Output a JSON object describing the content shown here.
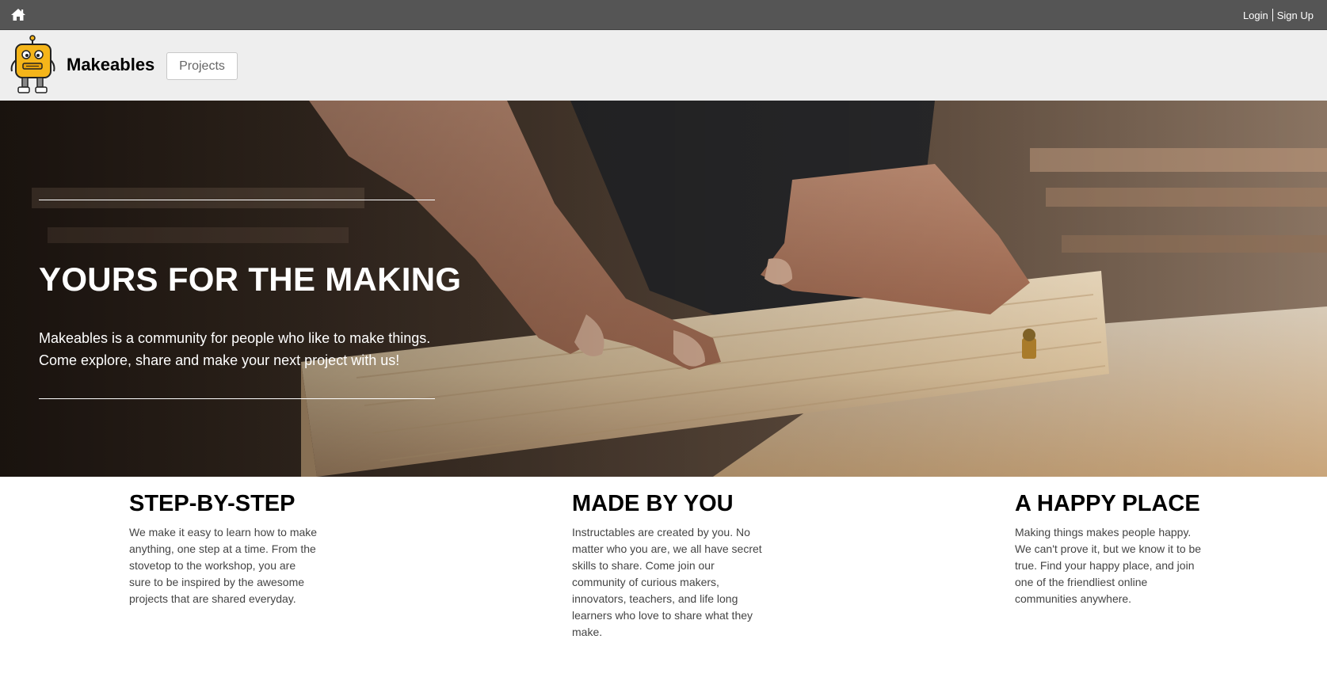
{
  "topbar": {
    "home_icon": "home-icon",
    "login_label": "Login",
    "signup_label": "Sign Up"
  },
  "header": {
    "logo_icon": "robot-mascot-icon",
    "brand": "Makeables",
    "nav": {
      "projects_label": "Projects"
    }
  },
  "hero": {
    "title": "YOURS FOR THE MAKING",
    "text_line1": "Makeables is a community for people who like to make things.",
    "text_line2": "Come explore, share and make your next project with us!"
  },
  "features": [
    {
      "title": "STEP-BY-STEP",
      "body": "We make it easy to learn how to make anything, one step at a time. From the stovetop to the workshop, you are sure to be inspired by the awesome projects that are shared everyday."
    },
    {
      "title": "MADE BY YOU",
      "body": "Instructables are created by you. No matter who you are, we all have secret skills to share. Come join our community of curious makers, innovators, teachers, and life long learners who love to share what they make."
    },
    {
      "title": "A HAPPY PLACE",
      "body": "Making things makes people happy. We can't prove it, but we know it to be true. Find your happy place, and join one of the friendliest online communities anywhere."
    }
  ],
  "colors": {
    "topbar_bg": "#555555",
    "header_bg": "#eeeeee",
    "mascot_yellow": "#f5b51a",
    "body_text": "#444444"
  }
}
